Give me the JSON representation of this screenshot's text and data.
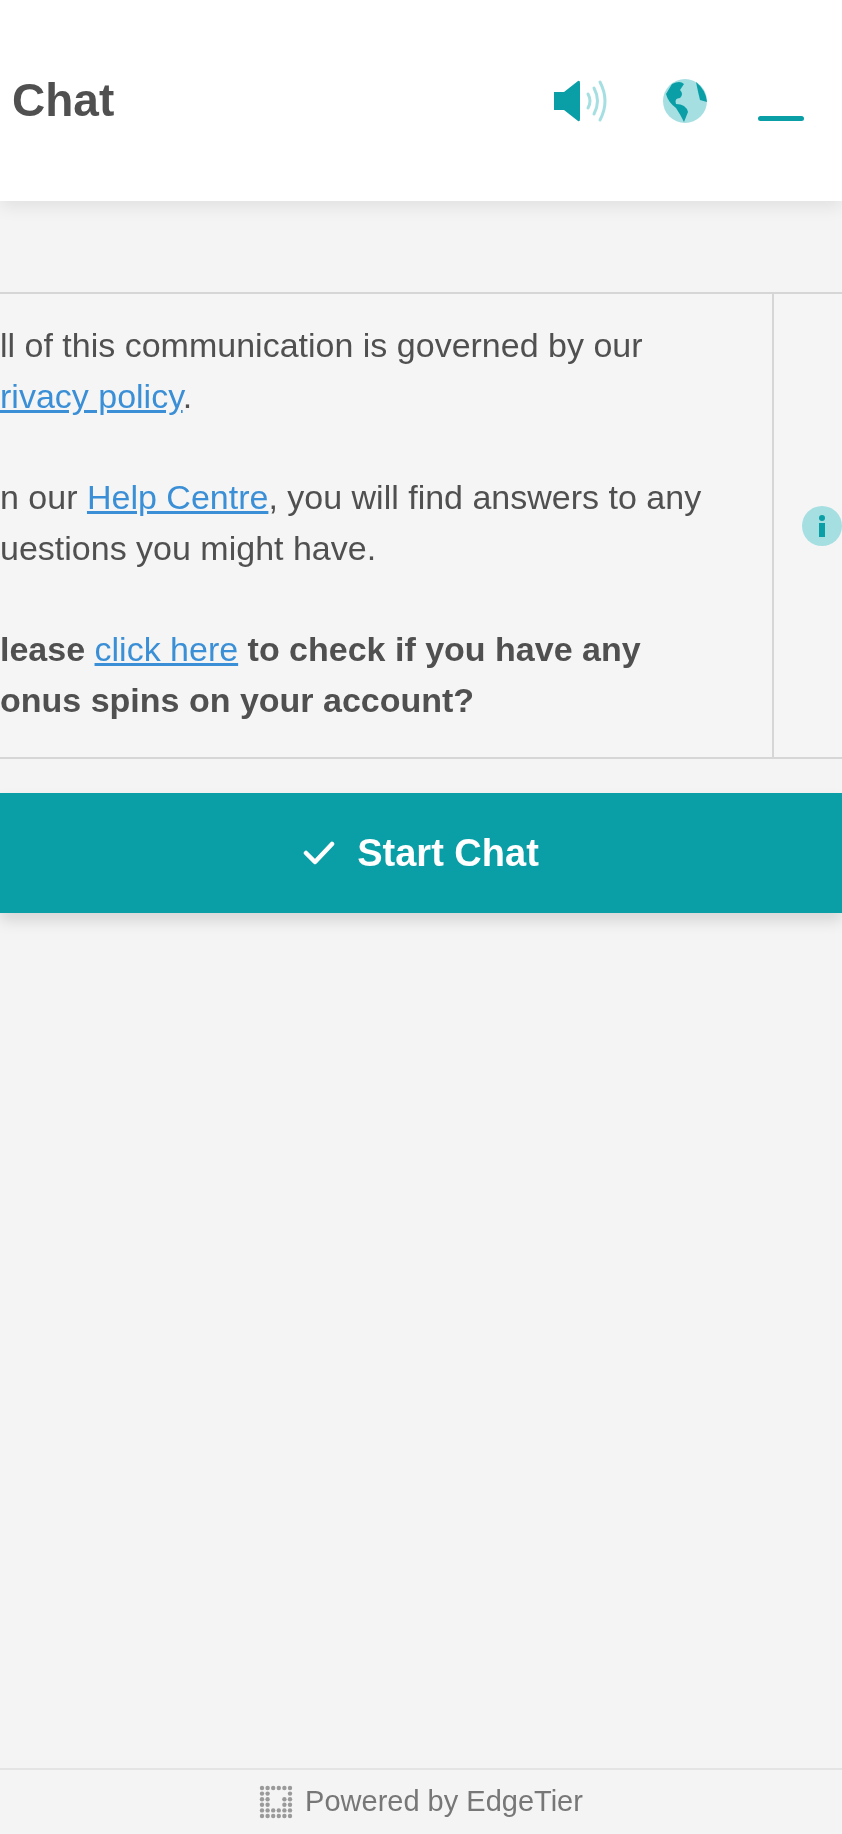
{
  "header": {
    "title": "Chat"
  },
  "notice": {
    "paragraphs": [
      {
        "bold": false,
        "segments": [
          {
            "kind": "text",
            "text": "ll of this communication is governed by our "
          },
          {
            "kind": "link",
            "text": "rivacy policy"
          },
          {
            "kind": "text",
            "text": "."
          }
        ]
      },
      {
        "bold": false,
        "segments": [
          {
            "kind": "text",
            "text": "n our "
          },
          {
            "kind": "link",
            "text": "Help Centre"
          },
          {
            "kind": "text",
            "text": ", you will find answers to any uestions you might have."
          }
        ]
      },
      {
        "bold": true,
        "segments": [
          {
            "kind": "text",
            "text": "lease "
          },
          {
            "kind": "link",
            "text": "click here"
          },
          {
            "kind": "text",
            "text": " to check if you have any onus spins on your account?"
          }
        ]
      }
    ]
  },
  "start_button": {
    "label": "Start Chat"
  },
  "footer": {
    "text": "Powered by EdgeTier"
  }
}
